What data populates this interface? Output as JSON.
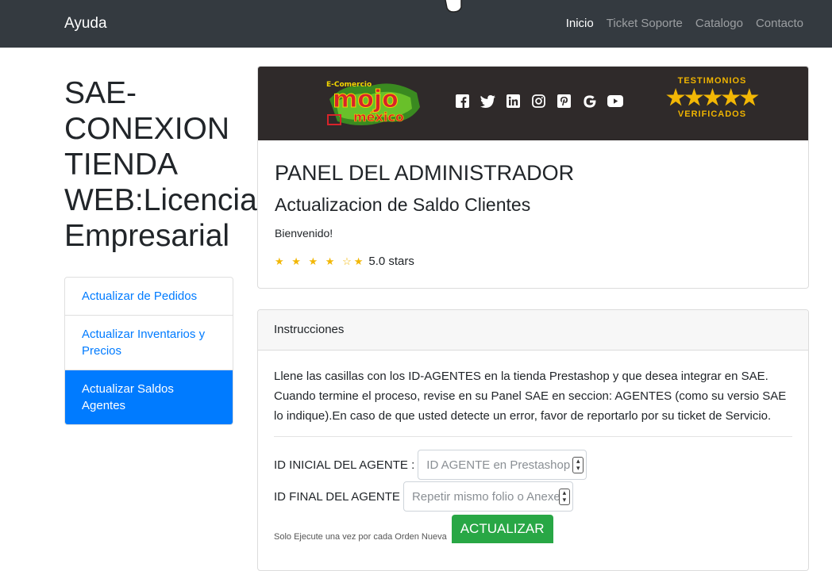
{
  "navbar": {
    "brand": "Ayuda",
    "links": [
      {
        "label": "Inicio",
        "active": true
      },
      {
        "label": "Ticket Soporte",
        "active": false
      },
      {
        "label": "Catalogo",
        "active": false
      },
      {
        "label": "Contacto",
        "active": false
      }
    ]
  },
  "page_title": "SAE-\nCONEXION\nTIENDA\nWEB:Licencia\nEmpresarial",
  "side_menu": [
    {
      "label": "Actualizar de Pedidos",
      "active": false
    },
    {
      "label": "Actualizar Inventarios y Precios",
      "active": false
    },
    {
      "label": "Actualizar Saldos Agentes",
      "active": true
    }
  ],
  "banner": {
    "logo_text": "E-Comercio mojo méxico",
    "social_icons": [
      "facebook-icon",
      "twitter-icon",
      "linkedin-icon",
      "instagram-icon",
      "pinterest-icon",
      "google-icon",
      "youtube-icon"
    ],
    "testimonios_top": "TESTIMONIOS",
    "testimonios_stars": "★★★★★",
    "testimonios_bottom": "VERIFICADOS"
  },
  "panel": {
    "title": "PANEL DEL ADMINISTRADOR",
    "subtitle": "Actualizacion de Saldo Clientes",
    "welcome": "Bienvenido!",
    "rating_stars": "★ ★ ★ ★ ☆★",
    "rating_text": "5.0 stars"
  },
  "instructions": {
    "header": "Instrucciones",
    "text": "Llene las casillas con los ID-AGENTES en la tienda Prestashop y que desea integrar en SAE. Cuando termine el proceso, revise en su Panel SAE en seccion: AGENTES (como su versio SAE lo indique).En caso de que usted detecte un error, favor de reportarlo por su ticket de Servicio.",
    "field1_label": "ID INICIAL DEL AGENTE :",
    "field1_placeholder": "ID AGENTE en Prestashop",
    "field2_label": "ID FINAL DEL AGENTE",
    "field2_placeholder": "Repetir mismo folio o Anexe",
    "note": "Solo Ejecute una vez por cada Orden Nueva",
    "button": "ACTUALIZAR"
  },
  "colors": {
    "navbar_bg": "#343a40",
    "primary": "#007bff",
    "success": "#28a745",
    "star": "#f2b705"
  }
}
